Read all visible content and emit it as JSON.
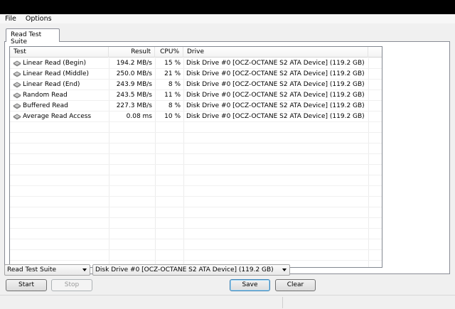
{
  "menu": {
    "file": "File",
    "options": "Options"
  },
  "tab": {
    "label": "Read Test Suite"
  },
  "columns": {
    "test": "Test",
    "result": "Result",
    "cpu": "CPU%",
    "drive": "Drive"
  },
  "rows": [
    {
      "test": "Linear Read (Begin)",
      "result": "194.2 MB/s",
      "cpu": "15 %",
      "drive": "Disk Drive #0  [OCZ-OCTANE S2 ATA Device]  (119.2 GB)"
    },
    {
      "test": "Linear Read (Middle)",
      "result": "250.0 MB/s",
      "cpu": "21 %",
      "drive": "Disk Drive #0  [OCZ-OCTANE S2 ATA Device]  (119.2 GB)"
    },
    {
      "test": "Linear Read (End)",
      "result": "243.9 MB/s",
      "cpu": "8 %",
      "drive": "Disk Drive #0  [OCZ-OCTANE S2 ATA Device]  (119.2 GB)"
    },
    {
      "test": "Random Read",
      "result": "243.5 MB/s",
      "cpu": "11 %",
      "drive": "Disk Drive #0  [OCZ-OCTANE S2 ATA Device]  (119.2 GB)"
    },
    {
      "test": "Buffered Read",
      "result": "227.3 MB/s",
      "cpu": "8 %",
      "drive": "Disk Drive #0  [OCZ-OCTANE S2 ATA Device]  (119.2 GB)"
    },
    {
      "test": "Average Read Access",
      "result": "0.08 ms",
      "cpu": "10 %",
      "drive": "Disk Drive #0  [OCZ-OCTANE S2 ATA Device]  (119.2 GB)"
    }
  ],
  "controls": {
    "suite_select": "Read Test Suite",
    "drive_select": "Disk Drive #0  [OCZ-OCTANE S2 ATA Device]  (119.2 GB)",
    "start": "Start",
    "stop": "Stop",
    "save": "Save",
    "clear": "Clear"
  },
  "icons": {
    "row_icon": "hard-disk-icon",
    "dropdown": "chevron-down-icon"
  },
  "colors": {
    "window_bg": "#f0f0f0",
    "default_button_border": "#3c7fb1"
  }
}
